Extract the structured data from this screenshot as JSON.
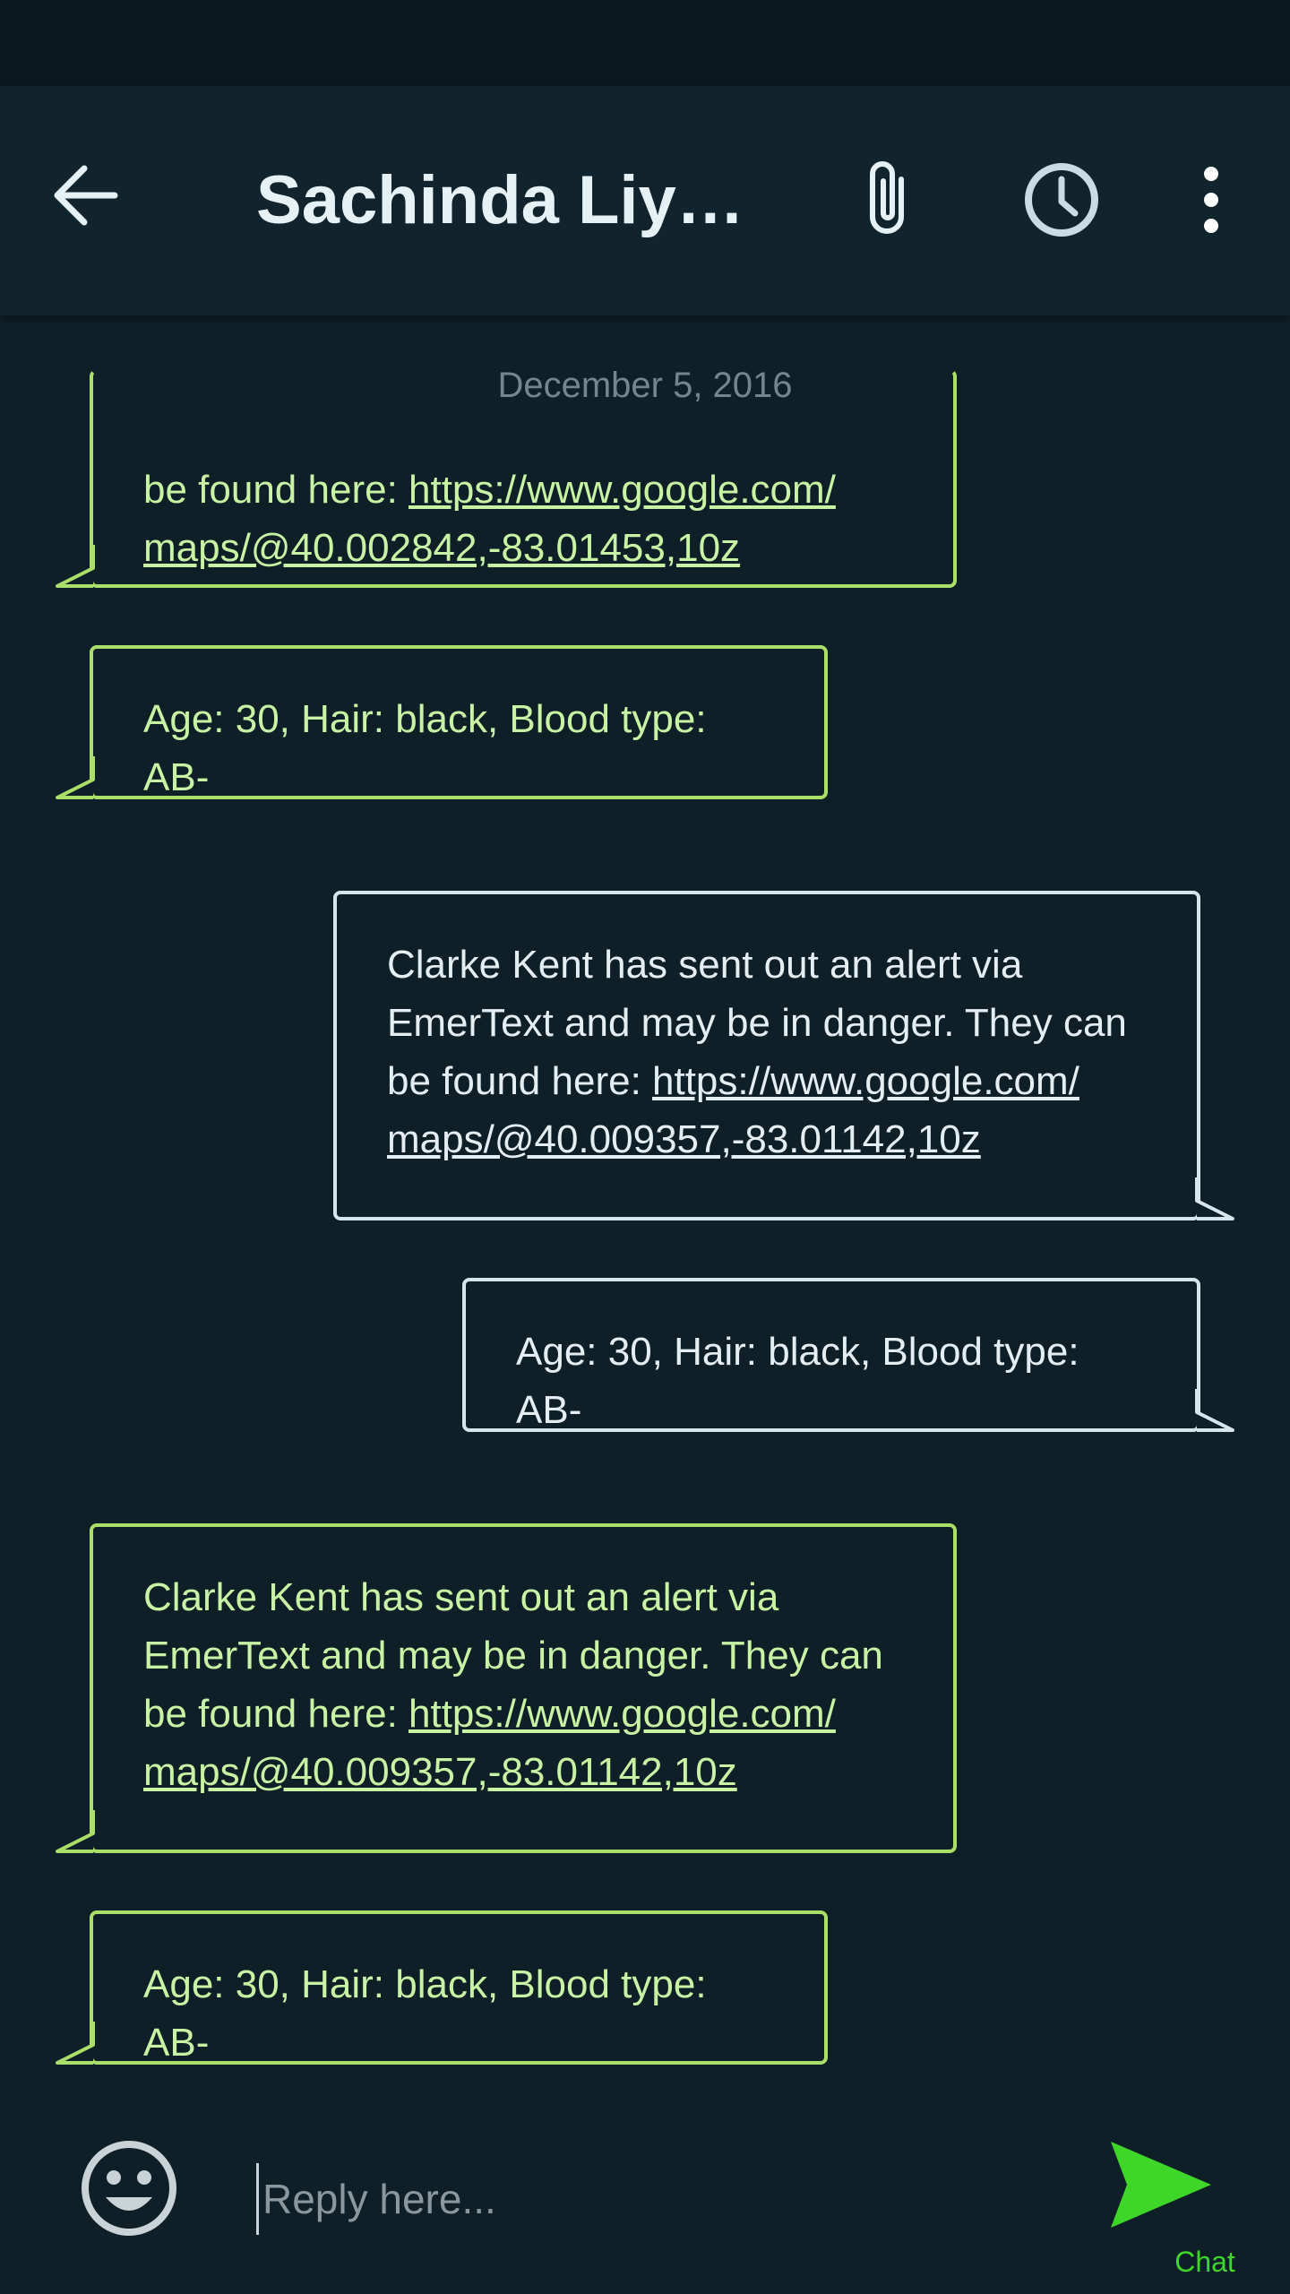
{
  "header": {
    "contact_name": "Sachinda Liya…"
  },
  "thread": {
    "date": "December 5, 2016",
    "messages": [
      {
        "direction": "incoming",
        "prefix": "be found here: ",
        "link": "https://www.google.com/maps/@40.002842,-83.01453,10z",
        "link_line1": "https://www.google.com/",
        "link_line2": "maps/@40.002842,-83.01453,10z"
      },
      {
        "direction": "incoming",
        "text": "Age: 30, Hair: black, Blood type: AB-"
      },
      {
        "direction": "outgoing",
        "line1": "Clarke Kent has sent out an alert via",
        "line2": "EmerText and may be in danger. They can",
        "prefix": "be found here: ",
        "link_line1": "https://www.google.com/",
        "link_line2": "maps/@40.009357,-83.01142,10z"
      },
      {
        "direction": "outgoing",
        "text": "Age: 30, Hair: black, Blood type: AB-"
      },
      {
        "direction": "incoming",
        "line1": "Clarke Kent has sent out an alert via",
        "line2": "EmerText and may be in danger. They can",
        "prefix": "be found here: ",
        "link_line1": "https://www.google.com/",
        "link_line2": "maps/@40.009357,-83.01142,10z"
      },
      {
        "direction": "incoming",
        "text": "Age: 30, Hair: black, Blood type: AB-"
      }
    ]
  },
  "composer": {
    "placeholder": "Reply here...",
    "value": "",
    "send_label": "Chat"
  },
  "icons": {
    "back": "arrow-back-icon",
    "attach": "paperclip-icon",
    "schedule": "clock-icon",
    "more": "more-vert-icon",
    "emoji": "smiley-icon",
    "send": "send-icon"
  },
  "colors": {
    "background": "#0f1f27",
    "toolbar": "#11242d",
    "incoming_border": "#a9df6a",
    "incoming_text": "#c8f2a4",
    "outgoing_border": "#d7e6ed",
    "outgoing_text": "#e4eef2",
    "send_accent": "#3fd62a"
  }
}
